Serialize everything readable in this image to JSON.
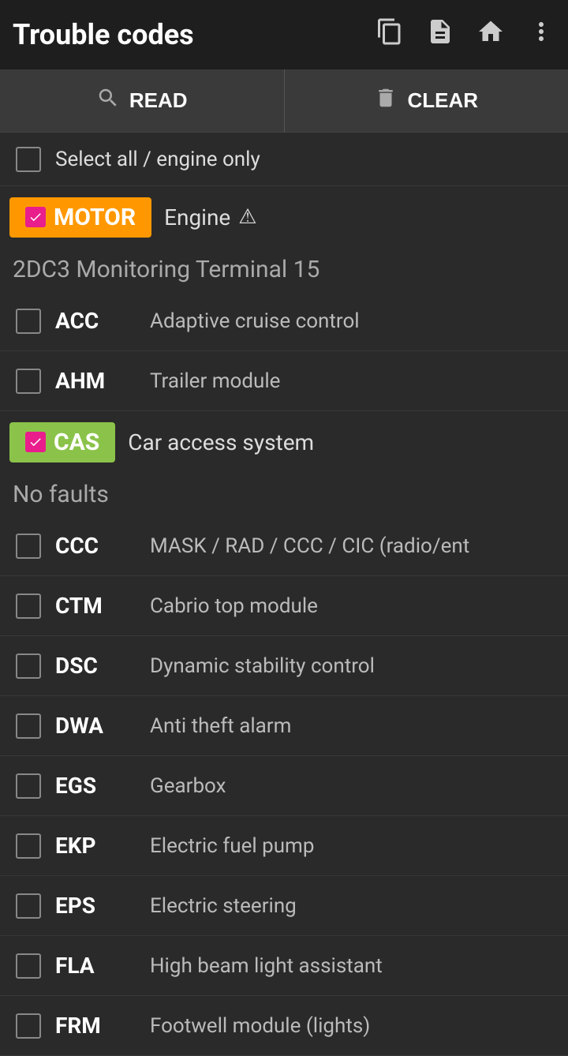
{
  "header": {
    "title": "Trouble codes",
    "icons": [
      "copy",
      "document",
      "home",
      "more"
    ]
  },
  "toolbar": {
    "read_label": "READ",
    "clear_label": "CLEAR"
  },
  "select_all": {
    "label": "Select all / engine only",
    "checked": false
  },
  "modules": [
    {
      "tag": "MOTOR",
      "tag_type": "motor",
      "checked": true,
      "name": "Engine",
      "has_warning": true,
      "subtitle": "2DC3 Monitoring Terminal 15",
      "items": [
        {
          "code": "ACC",
          "desc": "Adaptive cruise control",
          "checked": false
        },
        {
          "code": "AHM",
          "desc": "Trailer module",
          "checked": false
        }
      ]
    },
    {
      "tag": "CAS",
      "tag_type": "cas",
      "checked": true,
      "name": "Car access system",
      "has_warning": false,
      "subtitle": null,
      "no_faults": "No faults",
      "items": [
        {
          "code": "CCC",
          "desc": "MASK / RAD / CCC / CIC (radio/ent",
          "checked": false
        },
        {
          "code": "CTM",
          "desc": "Cabrio top module",
          "checked": false
        },
        {
          "code": "DSC",
          "desc": "Dynamic stability control",
          "checked": false
        },
        {
          "code": "DWA",
          "desc": "Anti theft alarm",
          "checked": false
        },
        {
          "code": "EGS",
          "desc": "Gearbox",
          "checked": false
        },
        {
          "code": "EKP",
          "desc": "Electric fuel pump",
          "checked": false
        },
        {
          "code": "EPS",
          "desc": "Electric steering",
          "checked": false
        },
        {
          "code": "FLA",
          "desc": "High beam light assistant",
          "checked": false
        },
        {
          "code": "FRM",
          "desc": "Footwell module (lights)",
          "checked": false
        }
      ]
    }
  ]
}
